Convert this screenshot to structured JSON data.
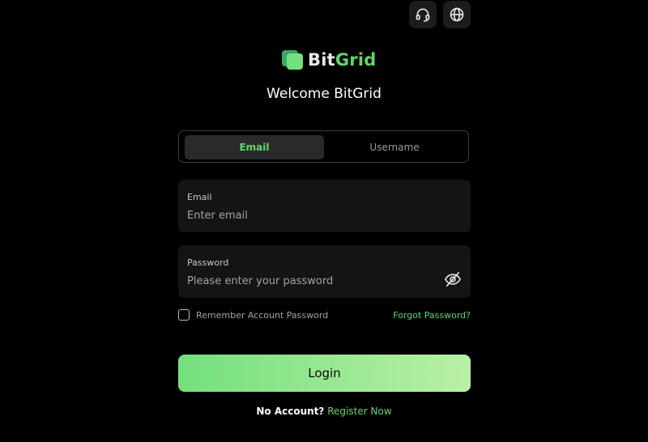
{
  "brand": {
    "name_part1": "Bit",
    "name_part2": "Grid",
    "accent_color": "#5fd66a"
  },
  "header": {
    "support_icon": "headset-icon",
    "language_icon": "globe-icon"
  },
  "welcome_title": "Welcome BitGrid",
  "tabs": [
    {
      "label": "Email",
      "active": true
    },
    {
      "label": "Username",
      "active": false
    }
  ],
  "form": {
    "email": {
      "label": "Email",
      "placeholder": "Enter email",
      "value": ""
    },
    "password": {
      "label": "Password",
      "placeholder": "Please enter your password",
      "value": "",
      "toggle_icon": "eye-off-icon"
    },
    "remember_label": "Remember Account Password",
    "remember_checked": false,
    "forgot_label": "Forgot Password?",
    "login_label": "Login"
  },
  "register": {
    "question": "No Account?",
    "link_label": "Register Now"
  }
}
